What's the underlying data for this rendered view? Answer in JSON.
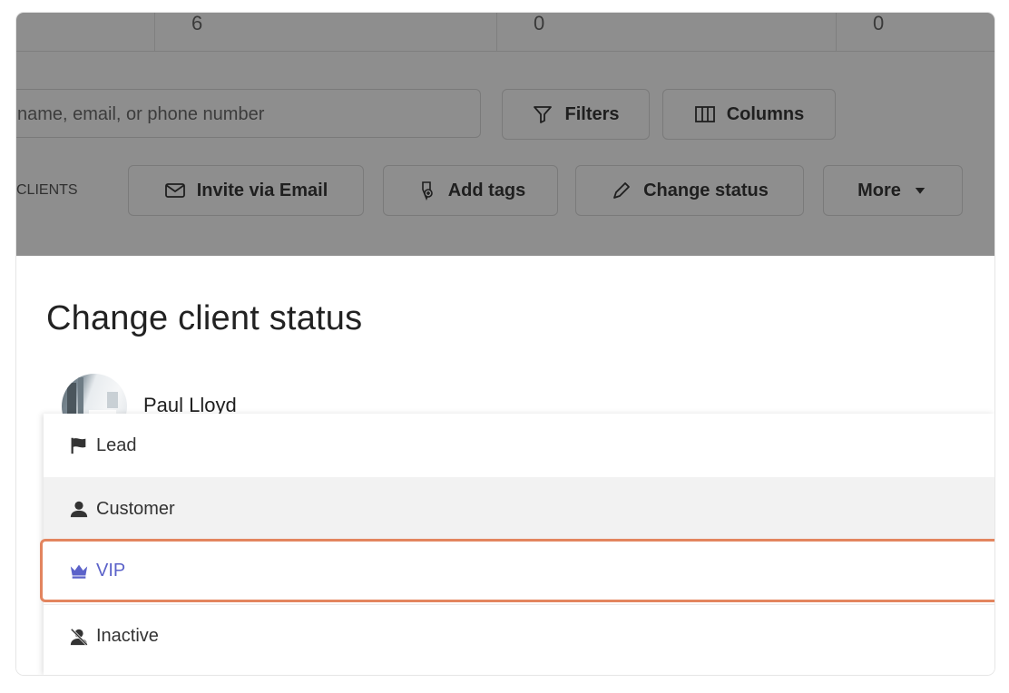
{
  "stats": {
    "values": [
      "6",
      "0",
      "0"
    ]
  },
  "toolbar": {
    "search_placeholder": "name, email, or phone number",
    "filters_label": "Filters",
    "columns_label": "Columns",
    "clients_label": "CLIENTS",
    "invite_label": "Invite via Email",
    "add_tags_label": "Add tags",
    "change_status_label": "Change status",
    "more_label": "More"
  },
  "modal": {
    "title": "Change client status",
    "client_name": "Paul Lloyd",
    "statuses": [
      {
        "label": "Lead",
        "icon": "flag-icon"
      },
      {
        "label": "Customer",
        "icon": "user-icon"
      },
      {
        "label": "VIP",
        "icon": "crown-icon"
      },
      {
        "label": "Inactive",
        "icon": "user-slash-icon"
      }
    ],
    "selected": "VIP",
    "accent_color": "#e3855f",
    "selected_text_color": "#5b62c9"
  }
}
